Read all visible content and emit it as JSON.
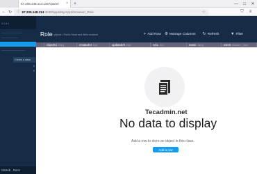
{
  "browser": {
    "tabs": [
      {
        "label": ""
      },
      {
        "label": "67.205.148.114:1337/parse"
      }
    ],
    "new_tab": "+",
    "window_controls": [
      "—",
      "□",
      "✕"
    ],
    "url_host": "67.205.148.114",
    "url_path": ":4040/apps/MyApp1/browser/_Role",
    "nav": {
      "back": "←",
      "forward": "→",
      "reload": "↻"
    }
  },
  "sidebar": {
    "version": "4.1.6.4",
    "create_class": "Create a class",
    "counts": [
      "0",
      "0"
    ],
    "footer": {
      "left": "GitHub",
      "right": "Docs"
    }
  },
  "toolbar": {
    "class_name": "Role",
    "subtitle": "0 objects • Public Read and Write enabled",
    "add_row": "Add Row",
    "manage_columns": "Manage Columns",
    "refresh": "Refresh",
    "filter": "Filter"
  },
  "columns": [
    {
      "name": "objectId",
      "type": "String"
    },
    {
      "name": "createdAt",
      "type": "Date"
    },
    {
      "name": "updatedAt",
      "type": "Date"
    },
    {
      "name": "ACL",
      "type": "ACL"
    },
    {
      "name": "name",
      "type": "String"
    },
    {
      "name": "users",
      "type": "Relation<_User>"
    }
  ],
  "empty_state": {
    "watermark": "Tecadmin.net",
    "title": "No data to display",
    "description": "Add a row to store an object in this class.",
    "button": "Add a row"
  },
  "colors": {
    "sidebar_bg": "#162c46",
    "sidebar_dark": "#0e1e33",
    "accent": "#169cee",
    "column_header": "#66637a"
  }
}
